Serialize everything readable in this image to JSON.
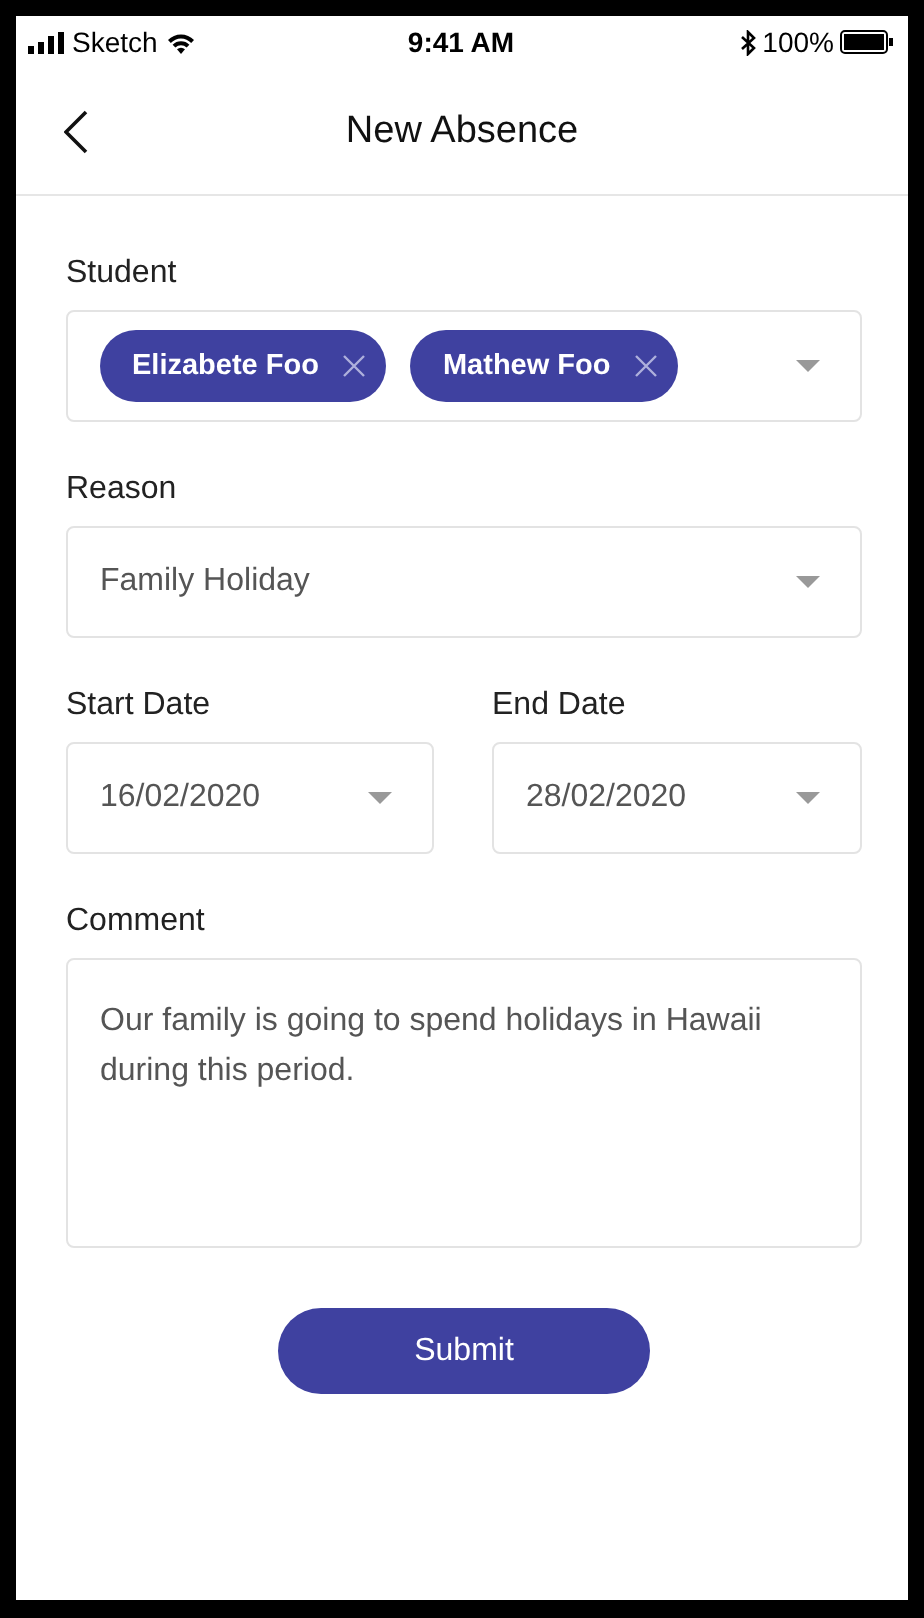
{
  "status_bar": {
    "carrier": "Sketch",
    "time": "9:41 AM",
    "battery": "100%"
  },
  "header": {
    "title": "New Absence"
  },
  "student": {
    "label": "Student",
    "chips": [
      {
        "label": "Elizabete Foo"
      },
      {
        "label": "Mathew Foo"
      }
    ]
  },
  "reason": {
    "label": "Reason",
    "value": "Family Holiday"
  },
  "dates": [
    {
      "label": "Start Date",
      "value": "16/02/2020"
    },
    {
      "label": "End Date",
      "value": "28/02/2020"
    }
  ],
  "comment": {
    "label": "Comment",
    "value": "Our family is going to spend holidays in Hawaii during this period."
  },
  "submit": {
    "label": "Submit"
  }
}
